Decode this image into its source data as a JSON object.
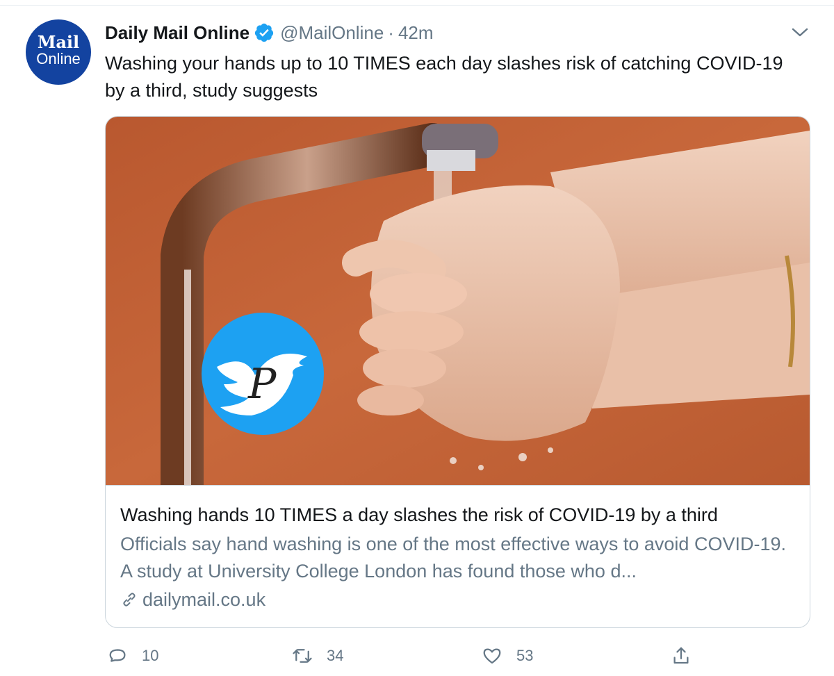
{
  "account": {
    "name": "Daily Mail Online",
    "handle": "@MailOnline",
    "separator": "·",
    "time": "42m",
    "avatar_logo_top": "Mail",
    "avatar_logo_bottom": "Online",
    "avatar_color": "#1343a0",
    "verified_color": "#1da1f2"
  },
  "tweet": {
    "text": "Washing your hands up to 10 TIMES each day slashes risk of catching COVID-19 by a third, study suggests"
  },
  "card": {
    "image_subject": "hands-washing-under-tap",
    "title": "Washing hands 10 TIMES a day slashes the risk of COVID-19 by a third",
    "description": "Officials say hand washing is one of the most effective ways to avoid COVID-19. A study at University College London has found those who d...",
    "domain": "dailymail.co.uk",
    "watermark_letter": "P"
  },
  "actions": {
    "reply_count": "10",
    "retweet_count": "34",
    "like_count": "53"
  },
  "colors": {
    "secondary_text": "#657786",
    "border": "#ccd6dd",
    "image_background": "#c2653a",
    "watermark_blue": "#1da1f2"
  }
}
